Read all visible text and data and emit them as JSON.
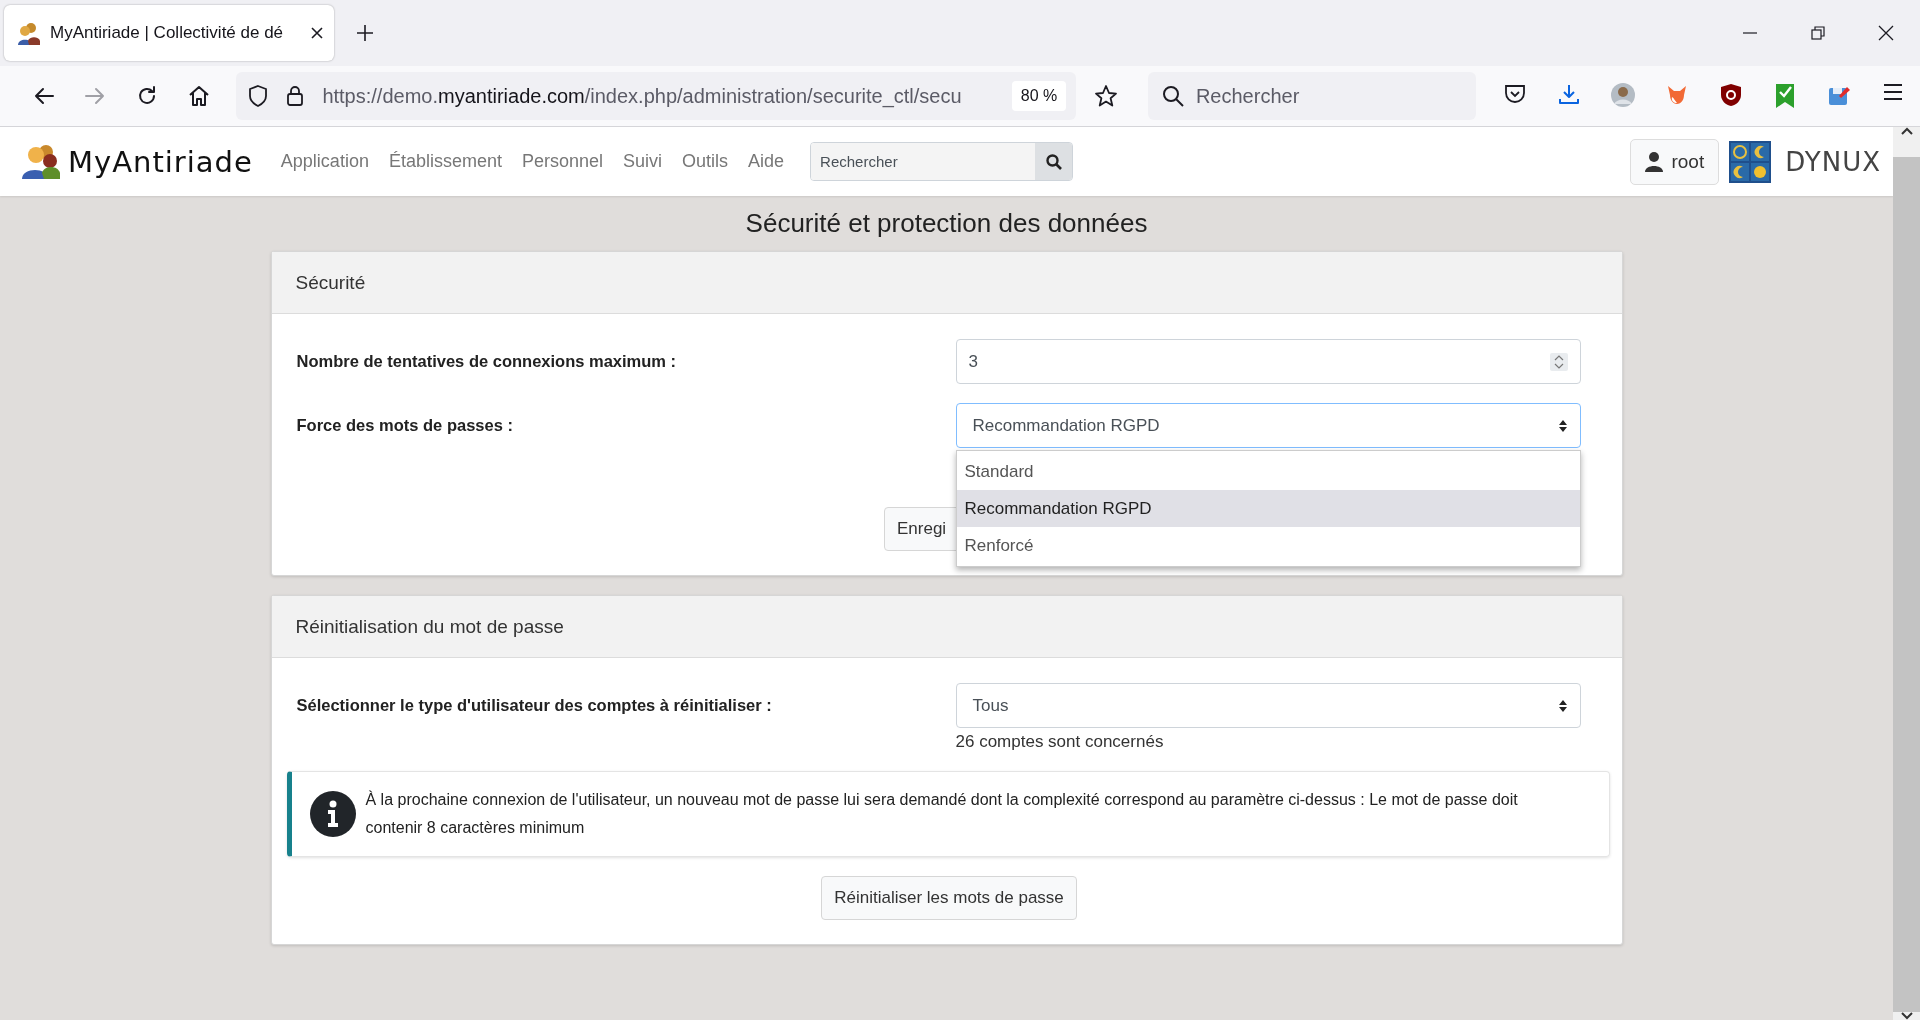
{
  "browser": {
    "tab": {
      "title": "MyAntiriade | Collectivité de dé",
      "selected": true
    },
    "address": {
      "prefix": "https://demo.",
      "host": "myantiriade.com",
      "path": "/index.php/administration/securite_ctl/secu"
    },
    "zoom": "80 %",
    "search": {
      "placeholder": "Rechercher"
    }
  },
  "header": {
    "brand": "MyAntiriade",
    "nav": [
      {
        "label": "Application"
      },
      {
        "label": "Établissement"
      },
      {
        "label": "Personnel"
      },
      {
        "label": "Suivi"
      },
      {
        "label": "Outils"
      },
      {
        "label": "Aide"
      }
    ],
    "search": {
      "placeholder": "Rechercher"
    },
    "user": "root",
    "partner": "DYNUX"
  },
  "title": "Sécurité et protection des données",
  "security": {
    "heading": "Sécurité",
    "max_attempts": {
      "label": "Nombre de tentatives de connexions maximum :",
      "value": "3"
    },
    "strength": {
      "label": "Force des mots de passes :",
      "value": "Recommandation RGPD",
      "expanded": true,
      "options": [
        {
          "label": "Standard",
          "selected": false
        },
        {
          "label": "Recommandation RGPD",
          "selected": true
        },
        {
          "label": "Renforcé",
          "selected": false
        }
      ]
    },
    "save_button": "Enregi"
  },
  "reset": {
    "heading": "Réinitialisation du mot de passe",
    "user_type": {
      "label": "Sélectionner le type d'utilisateur des comptes à réinitialiser :",
      "value": "Tous"
    },
    "count": "26 comptes sont concernés",
    "info": "À la prochaine connexion de l'utilisateur, un nouveau mot de passe lui sera demandé dont la complexité correspond au paramètre ci-dessus : Le mot de passe doit contenir 8 caractères minimum",
    "button": "Réinitialiser les mots de passe"
  }
}
